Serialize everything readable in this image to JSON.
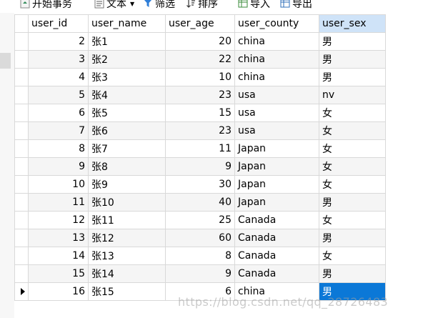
{
  "toolbar": {
    "begin_transaction": "开始事务",
    "text": "文本",
    "filter": "筛选",
    "sort": "排序",
    "import": "导入",
    "export": "导出"
  },
  "grid": {
    "columns": [
      "user_id",
      "user_name",
      "user_age",
      "user_county",
      "user_sex"
    ],
    "sorted_column": "user_sex",
    "rows": [
      [
        "2",
        "张1",
        "20",
        "china",
        "男"
      ],
      [
        "3",
        "张2",
        "22",
        "china",
        "男"
      ],
      [
        "4",
        "张3",
        "10",
        "china",
        "男"
      ],
      [
        "5",
        "张4",
        "23",
        "usa",
        "nv"
      ],
      [
        "6",
        "张5",
        "15",
        "usa",
        "女"
      ],
      [
        "7",
        "张6",
        "23",
        "usa",
        "女"
      ],
      [
        "8",
        "张7",
        "11",
        "Japan",
        "女"
      ],
      [
        "9",
        "张8",
        "9",
        "Japan",
        "女"
      ],
      [
        "10",
        "张9",
        "30",
        "Japan",
        "女"
      ],
      [
        "11",
        "张10",
        "40",
        "Japan",
        "男"
      ],
      [
        "12",
        "张11",
        "25",
        "Canada",
        "女"
      ],
      [
        "13",
        "张12",
        "60",
        "Canada",
        "男"
      ],
      [
        "14",
        "张13",
        "8",
        "Canada",
        "女"
      ],
      [
        "15",
        "张14",
        "9",
        "Canada",
        "男"
      ],
      [
        "16",
        "张15",
        "6",
        "china",
        "男"
      ]
    ],
    "selected_row": 14,
    "selected_col": 4
  },
  "watermark": "https://blog.csdn.net/qq_28726483",
  "colors": {
    "selected_cell": "#0b78d7",
    "sorted_header": "#cfe3f8",
    "alt_row": "#f5f5f5"
  }
}
